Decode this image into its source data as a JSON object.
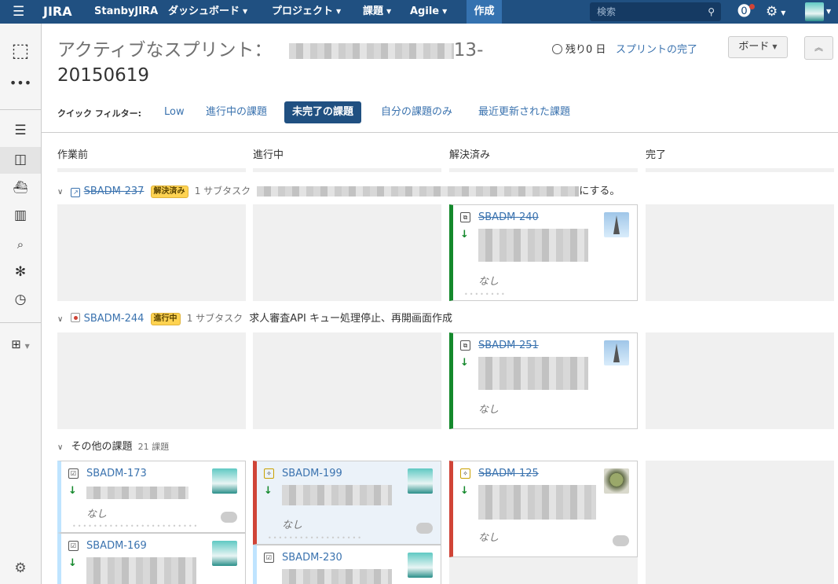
{
  "topbar": {
    "logo": "JIRA",
    "site": "StanbyJIRA",
    "nav": [
      "ダッシュボード",
      "プロジェクト",
      "課題",
      "Agile"
    ],
    "create": "作成",
    "search_placeholder": "検索"
  },
  "page": {
    "title_prefix": "アクティブなスプリント：",
    "title_suffix": "13-",
    "title_line2": "20150619",
    "remaining": "残り0 日",
    "complete_sprint": "スプリントの完了",
    "board_button": "ボード"
  },
  "quick_filters": {
    "label": "クイック フィルター:",
    "items": [
      "Low",
      "進行中の課題",
      "未完了の課題",
      "自分の課題のみ",
      "最近更新された課題"
    ],
    "active": "未完了の課題"
  },
  "columns": [
    "作業前",
    "進行中",
    "解決済み",
    "完了"
  ],
  "swimlanes": [
    {
      "key": "SBADM-237",
      "status": "解決済み",
      "subtasks": "1 サブタスク",
      "summary_tail": "にする。",
      "cards": [
        {
          "key": "SBADM-240",
          "priority": "なし",
          "column": "解決済み",
          "done": true
        }
      ]
    },
    {
      "key": "SBADM-244",
      "status": "進行中",
      "subtasks": "1 サブタスク",
      "summary": "求人審査API キュー処理停止、再開画面作成",
      "cards": [
        {
          "key": "SBADM-251",
          "priority": "なし",
          "column": "解決済み",
          "done": true
        }
      ]
    }
  ],
  "other_issues": {
    "label": "その他の課題",
    "count": "21 課題",
    "cards": [
      {
        "key": "SBADM-173",
        "priority": "なし",
        "column": "作業前"
      },
      {
        "key": "SBADM-169",
        "column": "作業前"
      },
      {
        "key": "SBADM-199",
        "priority": "なし",
        "column": "進行中"
      },
      {
        "key": "SBADM-230",
        "column": "進行中"
      },
      {
        "key": "SBADM-125",
        "priority": "なし",
        "column": "解決済み",
        "done": true
      }
    ]
  },
  "icons": [
    "menu-icon",
    "search-icon",
    "help-icon",
    "gear-icon",
    "project-box-icon",
    "backlog-icon",
    "board-icon",
    "releases-icon",
    "reports-icon",
    "issues-search-icon",
    "bug-icon",
    "components-icon",
    "structure-icon",
    "settings-icon"
  ]
}
